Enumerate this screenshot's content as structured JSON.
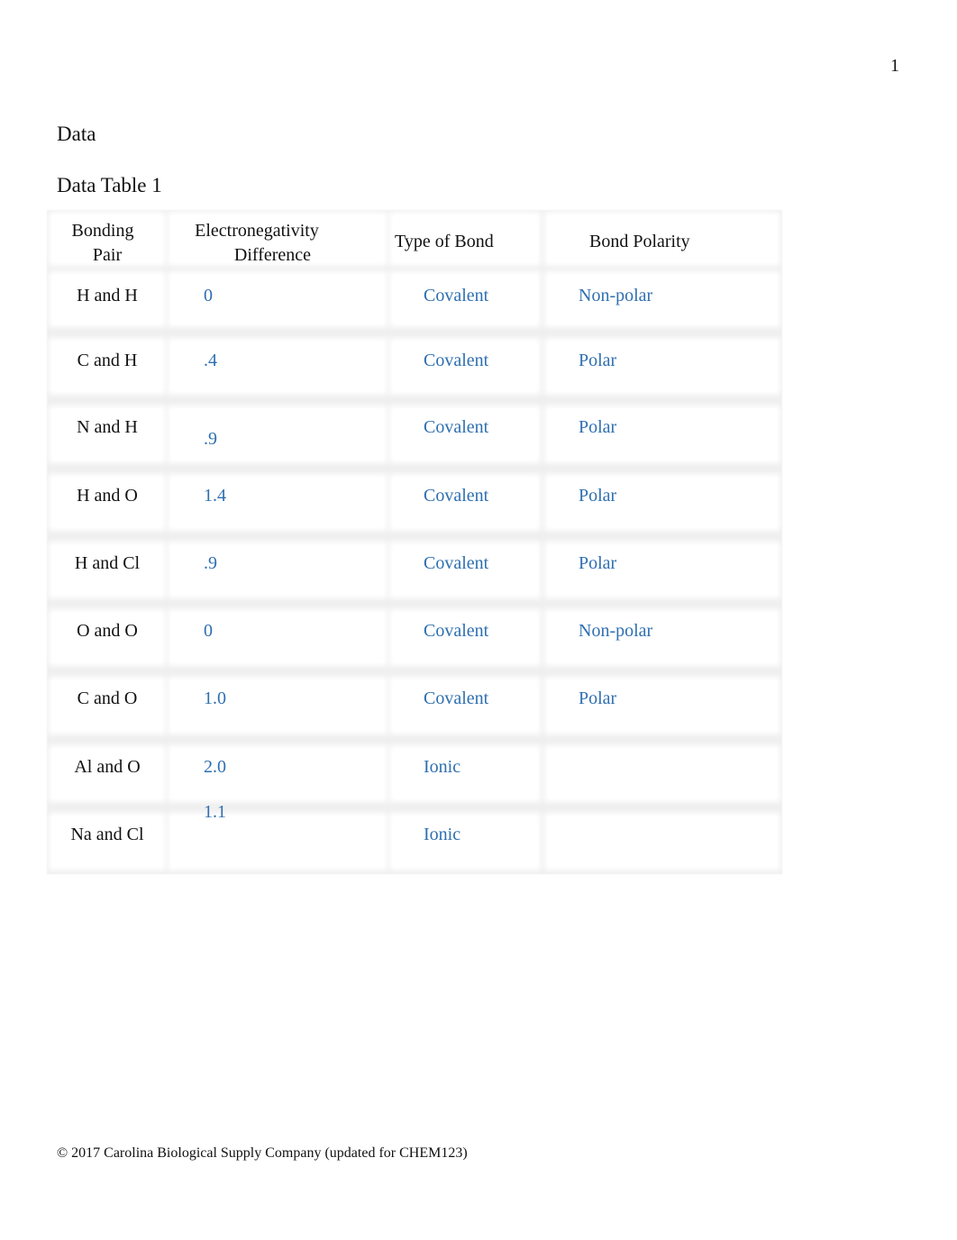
{
  "page_number": "1",
  "section_heading": "Data",
  "table_title": "Data Table 1",
  "table": {
    "headers": [
      "Bonding\nPair",
      "Electronegativity\nDifference",
      "Type of Bond",
      "Bond Polarity"
    ],
    "header_lines": {
      "col0": [
        "Bonding",
        "Pair"
      ],
      "col1": [
        "Electronegativity",
        "Difference"
      ],
      "col2": [
        "Type of Bond"
      ],
      "col3": [
        "Bond Polarity"
      ]
    },
    "rows": [
      {
        "pair": "H and H",
        "difference": "0",
        "bond_type": "Covalent",
        "polarity": "Non-polar"
      },
      {
        "pair": "C and H",
        "difference": ".4",
        "bond_type": "Covalent",
        "polarity": "Polar"
      },
      {
        "pair": "N and H",
        "difference": ".9",
        "bond_type": "Covalent",
        "polarity": "Polar"
      },
      {
        "pair": "H and O",
        "difference": "1.4",
        "bond_type": "Covalent",
        "polarity": "Polar"
      },
      {
        "pair": "H and Cl",
        "difference": ".9",
        "bond_type": "Covalent",
        "polarity": "Polar"
      },
      {
        "pair": "O and O",
        "difference": "0",
        "bond_type": "Covalent",
        "polarity": "Non-polar"
      },
      {
        "pair": "C and O",
        "difference": "1.0",
        "bond_type": "Covalent",
        "polarity": "Polar"
      },
      {
        "pair": "Al and O",
        "difference": "2.0",
        "bond_type": "Ionic",
        "polarity": ""
      },
      {
        "pair": "Na and Cl",
        "difference": "1.1",
        "bond_type": "Ionic",
        "polarity": ""
      }
    ]
  },
  "colors": {
    "answer_text": "#2e6fb0",
    "border": "#e6e6e6"
  },
  "footer": "© 2017 Carolina Biological Supply Company (updated for CHEM123)"
}
